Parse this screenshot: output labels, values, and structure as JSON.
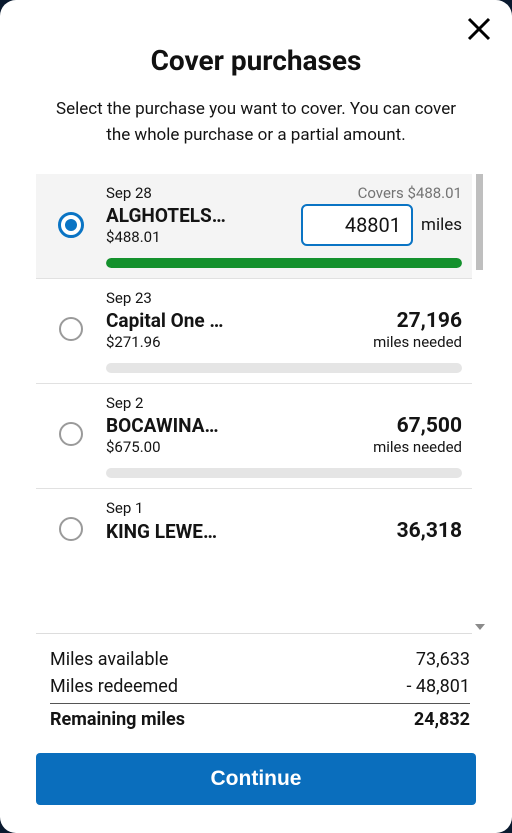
{
  "modal": {
    "title": "Cover purchases",
    "subtitle": "Select the purchase you want to cover. You can cover the whole purchase or a partial amount.",
    "continue_label": "Continue"
  },
  "selected": {
    "date": "Sep 28",
    "merchant": "ALGHOTELS…",
    "amount": "$488.01",
    "covers_label": "Covers $488.01",
    "miles_value": "48801",
    "miles_unit": "miles",
    "bar_fill_pct": "100%"
  },
  "items": [
    {
      "date": "Sep 23",
      "merchant": "Capital One …",
      "amount": "$271.96",
      "miles": "27,196",
      "miles_needed_label": "miles needed"
    },
    {
      "date": "Sep 2",
      "merchant": "BOCAWINA…",
      "amount": "$675.00",
      "miles": "67,500",
      "miles_needed_label": "miles needed"
    }
  ],
  "partial": {
    "date": "Sep 1",
    "merchant": "KING LEWE…",
    "miles": "36,318"
  },
  "summary": {
    "available_label": "Miles available",
    "available_value": "73,633",
    "redeemed_label": "Miles redeemed",
    "redeemed_value": "- 48,801",
    "remaining_label": "Remaining miles",
    "remaining_value": "24,832"
  }
}
